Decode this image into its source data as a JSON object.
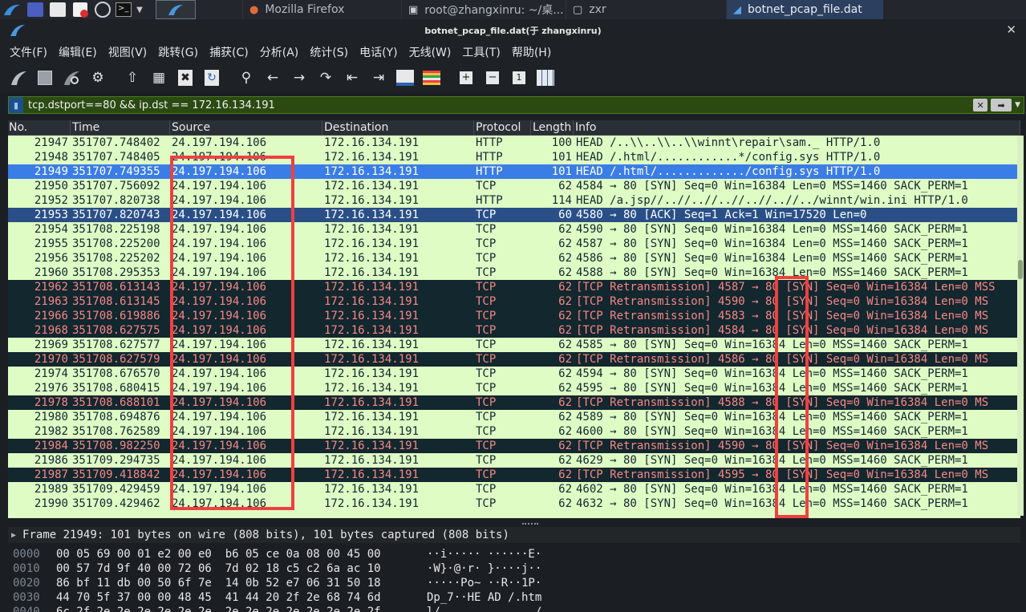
{
  "taskbar": {
    "windows": [
      {
        "icon": "firefox-icon",
        "glyph": "●",
        "label": "Mozilla Firefox"
      },
      {
        "icon": "terminal-icon",
        "glyph": "▣",
        "label": "root@zhangxinru: ~/桌..."
      },
      {
        "icon": "folder-icon",
        "glyph": "▢",
        "label": "zxr"
      },
      {
        "icon": "wireshark-icon",
        "glyph": "◢",
        "label": "botnet_pcap_file.dat"
      }
    ]
  },
  "window": {
    "title": "botnet_pcap_file.dat(于 zhangxinru)"
  },
  "menu": [
    "文件(F)",
    "编辑(E)",
    "视图(V)",
    "跳转(G)",
    "捕获(C)",
    "分析(A)",
    "统计(S)",
    "电话(Y)",
    "无线(W)",
    "工具(T)",
    "帮助(H)"
  ],
  "filter": {
    "value": "tcp.dstport==80 && ip.dst == 172.16.134.191"
  },
  "columns": [
    "No.",
    "Time",
    "Source",
    "Destination",
    "Protocol",
    "Length",
    "Info"
  ],
  "packets": [
    {
      "no": "21947",
      "time": "351707.748402",
      "src": "24.197.194.106",
      "dst": "172.16.134.191",
      "proto": "HTTP",
      "len": "100",
      "info": "HEAD /..\\\\..\\\\..\\\\winnt\\repair\\sam._ HTTP/1.0",
      "style": "norm"
    },
    {
      "no": "21948",
      "time": "351707.748405",
      "src": "24.197.194.106",
      "dst": "172.16.134.191",
      "proto": "HTTP",
      "len": "101",
      "info": "HEAD /.html/............*/config.sys HTTP/1.0",
      "style": "norm"
    },
    {
      "no": "21949",
      "time": "351707.749355",
      "src": "24.197.194.106",
      "dst": "172.16.134.191",
      "proto": "HTTP",
      "len": "101",
      "info": "HEAD /.html/............./config.sys HTTP/1.0",
      "style": "sel"
    },
    {
      "no": "21950",
      "time": "351707.756092",
      "src": "24.197.194.106",
      "dst": "172.16.134.191",
      "proto": "TCP",
      "len": "62",
      "info": "4584 → 80 [SYN] Seq=0 Win=16384 Len=0 MSS=1460 SACK_PERM=1",
      "style": "norm"
    },
    {
      "no": "21952",
      "time": "351707.820738",
      "src": "24.197.194.106",
      "dst": "172.16.134.191",
      "proto": "HTTP",
      "len": "114",
      "info": "HEAD /a.jsp//..//..//..//..//..//../winnt/win.ini HTTP/1.0",
      "style": "norm"
    },
    {
      "no": "21953",
      "time": "351707.820743",
      "src": "24.197.194.106",
      "dst": "172.16.134.191",
      "proto": "TCP",
      "len": "60",
      "info": "4580 → 80 [ACK] Seq=1 Ack=1 Win=17520 Len=0",
      "style": "ack"
    },
    {
      "no": "21954",
      "time": "351708.225198",
      "src": "24.197.194.106",
      "dst": "172.16.134.191",
      "proto": "TCP",
      "len": "62",
      "info": "4590 → 80 [SYN] Seq=0 Win=16384 Len=0 MSS=1460 SACK_PERM=1",
      "style": "norm"
    },
    {
      "no": "21955",
      "time": "351708.225200",
      "src": "24.197.194.106",
      "dst": "172.16.134.191",
      "proto": "TCP",
      "len": "62",
      "info": "4587 → 80 [SYN] Seq=0 Win=16384 Len=0 MSS=1460 SACK_PERM=1",
      "style": "norm"
    },
    {
      "no": "21956",
      "time": "351708.225202",
      "src": "24.197.194.106",
      "dst": "172.16.134.191",
      "proto": "TCP",
      "len": "62",
      "info": "4586 → 80 [SYN] Seq=0 Win=16384 Len=0 MSS=1460 SACK_PERM=1",
      "style": "norm"
    },
    {
      "no": "21960",
      "time": "351708.295353",
      "src": "24.197.194.106",
      "dst": "172.16.134.191",
      "proto": "TCP",
      "len": "62",
      "info": "4588 → 80 [SYN] Seq=0 Win=16384 Len=0 MSS=1460 SACK_PERM=1",
      "style": "norm"
    },
    {
      "no": "21962",
      "time": "351708.613143",
      "src": "24.197.194.106",
      "dst": "172.16.134.191",
      "proto": "TCP",
      "len": "62",
      "info": "[TCP Retransmission] 4587 → 80 [SYN] Seq=0 Win=16384 Len=0 MSS",
      "style": "retrans"
    },
    {
      "no": "21963",
      "time": "351708.613145",
      "src": "24.197.194.106",
      "dst": "172.16.134.191",
      "proto": "TCP",
      "len": "62",
      "info": "[TCP Retransmission] 4590 → 80 [SYN] Seq=0 Win=16384 Len=0 MS",
      "style": "retrans"
    },
    {
      "no": "21966",
      "time": "351708.619886",
      "src": "24.197.194.106",
      "dst": "172.16.134.191",
      "proto": "TCP",
      "len": "62",
      "info": "[TCP Retransmission] 4583 → 80 [SYN] Seq=0 Win=16384 Len=0 MS",
      "style": "retrans"
    },
    {
      "no": "21968",
      "time": "351708.627575",
      "src": "24.197.194.106",
      "dst": "172.16.134.191",
      "proto": "TCP",
      "len": "62",
      "info": "[TCP Retransmission] 4584 → 80 [SYN] Seq=0 Win=16384 Len=0 MS",
      "style": "retrans"
    },
    {
      "no": "21969",
      "time": "351708.627577",
      "src": "24.197.194.106",
      "dst": "172.16.134.191",
      "proto": "TCP",
      "len": "62",
      "info": "4585 → 80 [SYN] Seq=0 Win=16384 Len=0 MSS=1460 SACK_PERM=1",
      "style": "norm"
    },
    {
      "no": "21970",
      "time": "351708.627579",
      "src": "24.197.194.106",
      "dst": "172.16.134.191",
      "proto": "TCP",
      "len": "62",
      "info": "[TCP Retransmission] 4586 → 80 [SYN] Seq=0 Win=16384 Len=0 MS",
      "style": "retrans"
    },
    {
      "no": "21974",
      "time": "351708.676570",
      "src": "24.197.194.106",
      "dst": "172.16.134.191",
      "proto": "TCP",
      "len": "62",
      "info": "4594 → 80 [SYN] Seq=0 Win=16384 Len=0 MSS=1460 SACK_PERM=1",
      "style": "norm"
    },
    {
      "no": "21976",
      "time": "351708.680415",
      "src": "24.197.194.106",
      "dst": "172.16.134.191",
      "proto": "TCP",
      "len": "62",
      "info": "4595 → 80 [SYN] Seq=0 Win=16384 Len=0 MSS=1460 SACK_PERM=1",
      "style": "norm"
    },
    {
      "no": "21978",
      "time": "351708.688101",
      "src": "24.197.194.106",
      "dst": "172.16.134.191",
      "proto": "TCP",
      "len": "62",
      "info": "[TCP Retransmission] 4588 → 80 [SYN] Seq=0 Win=16384 Len=0 MS",
      "style": "retrans"
    },
    {
      "no": "21980",
      "time": "351708.694876",
      "src": "24.197.194.106",
      "dst": "172.16.134.191",
      "proto": "TCP",
      "len": "62",
      "info": "4589 → 80 [SYN] Seq=0 Win=16384 Len=0 MSS=1460 SACK_PERM=1",
      "style": "norm"
    },
    {
      "no": "21982",
      "time": "351708.762589",
      "src": "24.197.194.106",
      "dst": "172.16.134.191",
      "proto": "TCP",
      "len": "62",
      "info": "4600 → 80 [SYN] Seq=0 Win=16384 Len=0 MSS=1460 SACK_PERM=1",
      "style": "norm"
    },
    {
      "no": "21984",
      "time": "351708.982250",
      "src": "24.197.194.106",
      "dst": "172.16.134.191",
      "proto": "TCP",
      "len": "62",
      "info": "[TCP Retransmission] 4590 → 80 [SYN] Seq=0 Win=16384 Len=0 MS",
      "style": "retrans"
    },
    {
      "no": "21986",
      "time": "351709.294735",
      "src": "24.197.194.106",
      "dst": "172.16.134.191",
      "proto": "TCP",
      "len": "62",
      "info": "4629 → 80 [SYN] Seq=0 Win=16384 Len=0 MSS=1460 SACK_PERM=1",
      "style": "norm"
    },
    {
      "no": "21987",
      "time": "351709.418842",
      "src": "24.197.194.106",
      "dst": "172.16.134.191",
      "proto": "TCP",
      "len": "62",
      "info": "[TCP Retransmission] 4595 → 80 [SYN] Seq=0 Win=16384 Len=0 MS",
      "style": "retrans"
    },
    {
      "no": "21989",
      "time": "351709.429459",
      "src": "24.197.194.106",
      "dst": "172.16.134.191",
      "proto": "TCP",
      "len": "62",
      "info": "4602 → 80 [SYN] Seq=0 Win=16384 Len=0 MSS=1460 SACK_PERM=1",
      "style": "norm"
    },
    {
      "no": "21990",
      "time": "351709.429462",
      "src": "24.197.194.106",
      "dst": "172.16.134.191",
      "proto": "TCP",
      "len": "62",
      "info": "4632 → 80 [SYN] Seq=0 Win=16384 Len=0 MSS=1460 SACK_PERM=1",
      "style": "norm"
    }
  ],
  "detail": {
    "summary": "Frame 21949: 101 bytes on wire (808 bits), 101 bytes captured (808 bits)"
  },
  "hex": [
    {
      "off": "0000",
      "bytes": "00 05 69 00 01 e2 00 e0  b6 05 ce 0a 08 00 45 00",
      "ascii": "··i····· ······E·"
    },
    {
      "off": "0010",
      "bytes": "00 57 7d 9f 40 00 72 06  7d 02 18 c5 c2 6a ac 10",
      "ascii": "·W}·@·r· }····j··"
    },
    {
      "off": "0020",
      "bytes": "86 bf 11 db 00 50 6f 7e  14 0b 52 e7 06 31 50 18",
      "ascii": "·····Po~ ··R··1P·"
    },
    {
      "off": "0030",
      "bytes": "44 70 5f 37 00 00 48 45  41 44 20 2f 2e 68 74 6d",
      "ascii": "Dp_7··HE AD /.htm"
    },
    {
      "off": "0040",
      "bytes": "6c 2f 2e 2e 2e 2e 2e 2e  2e 2e 2e 2e 2e 2e 2e 2f",
      "ascii": "l/...... ......./"
    }
  ],
  "colors": {
    "normal_row": "#e0fcc5",
    "retrans_row": "#12272e",
    "retrans_text": "#f78787",
    "selected_row": "#3b7de6",
    "ack_row": "#2a4f86",
    "filter_bg": "#2a4a12",
    "annotation": "#ef4040"
  }
}
